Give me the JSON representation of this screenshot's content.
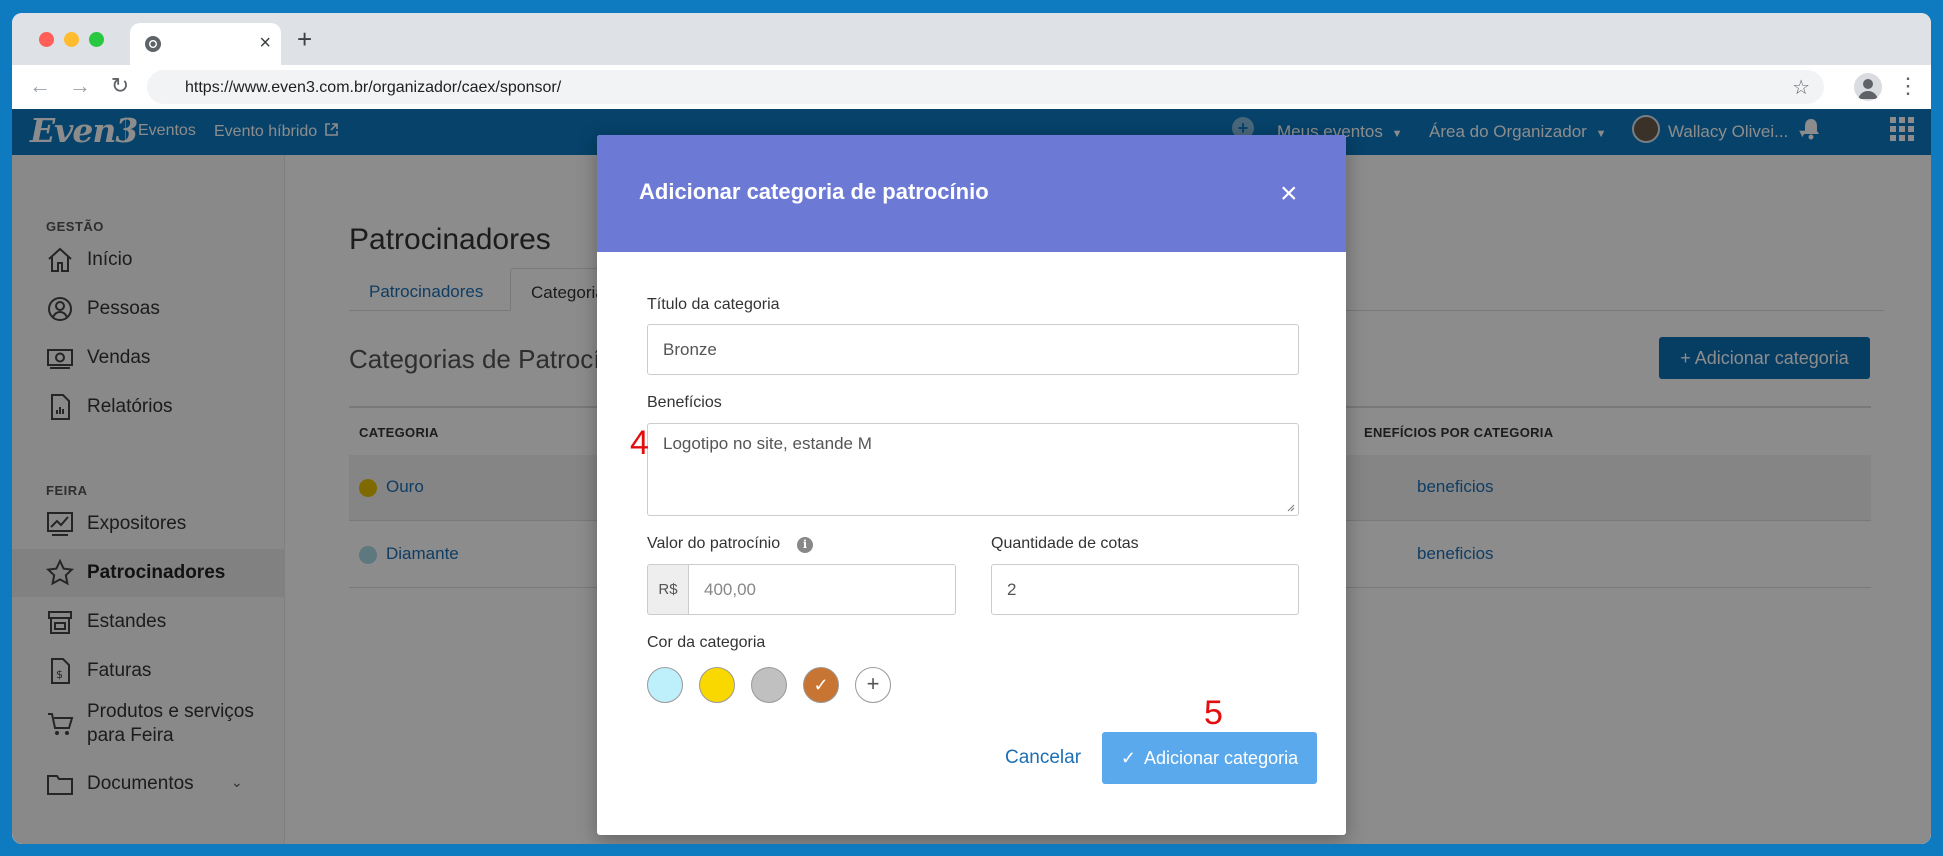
{
  "browser": {
    "tab_close": "×",
    "new_tab": "+",
    "url": "https://www.even3.com.br/organizador/caex/sponsor/"
  },
  "topbar": {
    "logo": "Even3",
    "nav_eventos": "Eventos",
    "nav_hibrido": "Evento híbrido",
    "meus_eventos": "Meus eventos",
    "area_organizador": "Área do Organizador",
    "user_name": "Wallacy Olivei..."
  },
  "sidebar": {
    "section_gestao": "GESTÃO",
    "section_feira": "FEIRA",
    "items": [
      {
        "label": "Início",
        "icon": "home-icon"
      },
      {
        "label": "Pessoas",
        "icon": "person-icon"
      },
      {
        "label": "Vendas",
        "icon": "money-icon"
      },
      {
        "label": "Relatórios",
        "icon": "report-icon"
      },
      {
        "label": "Expositores",
        "icon": "chart-icon"
      },
      {
        "label": "Patrocinadores",
        "icon": "star-icon"
      },
      {
        "label": "Estandes",
        "icon": "store-icon"
      },
      {
        "label": "Faturas",
        "icon": "invoice-icon"
      },
      {
        "label_line1": "Produtos e serviços",
        "label_line2": "para Feira",
        "icon": "cart-icon"
      },
      {
        "label": "Documentos",
        "icon": "folder-icon"
      }
    ]
  },
  "main": {
    "page_title": "Patrocinadores",
    "tabs": [
      "Patrocinadores",
      "Categoria"
    ],
    "section_title": "Categorias de Patrocín",
    "add_button": "+ Adicionar categoria",
    "col_categoria": "CATEGORIA",
    "col_beneficios": "ENEFÍCIOS POR CATEGORIA",
    "rows": [
      {
        "name": "Ouro",
        "benefits": "beneficios",
        "color": "#e6c200"
      },
      {
        "name": "Diamante",
        "benefits": "beneficios",
        "color": "#a9dbe8"
      }
    ]
  },
  "modal": {
    "title": "Adicionar categoria de patrocínio",
    "close": "×",
    "titulo_label": "Título da categoria",
    "titulo_value": "Bronze",
    "beneficios_label": "Benefícios",
    "beneficios_value": "Logotipo no site, estande M",
    "valor_label": "Valor do patrocínio",
    "currency": "R$",
    "valor_value": "400,00",
    "quantidade_label": "Quantidade de cotas",
    "quantidade_value": "2",
    "cor_label": "Cor da categoria",
    "colors": [
      {
        "name": "light-blue",
        "hex": "#bdf0fa",
        "selected": false
      },
      {
        "name": "yellow",
        "hex": "#f9d800",
        "selected": false
      },
      {
        "name": "gray",
        "hex": "#c0c0c0",
        "selected": false
      },
      {
        "name": "bronze",
        "hex": "#c87533",
        "selected": true
      }
    ],
    "add_color": "+",
    "cancel": "Cancelar",
    "submit": "Adicionar categoria"
  },
  "annotations": {
    "step4": "4",
    "step5": "5"
  }
}
